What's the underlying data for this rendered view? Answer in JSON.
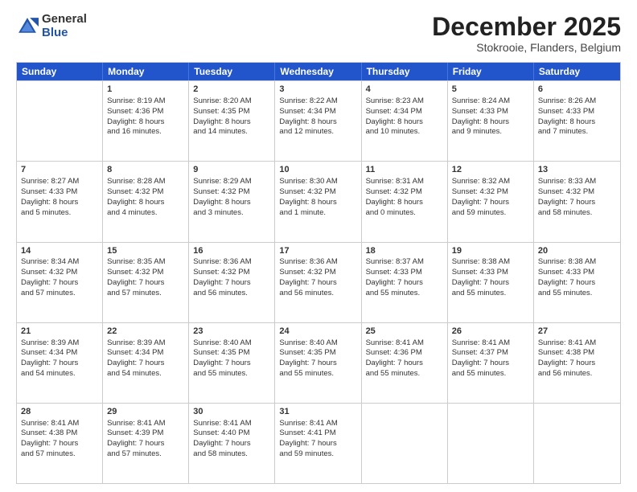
{
  "logo": {
    "general": "General",
    "blue": "Blue"
  },
  "title": "December 2025",
  "subtitle": "Stokrooie, Flanders, Belgium",
  "headers": [
    "Sunday",
    "Monday",
    "Tuesday",
    "Wednesday",
    "Thursday",
    "Friday",
    "Saturday"
  ],
  "rows": [
    [
      {
        "day": "",
        "lines": []
      },
      {
        "day": "1",
        "lines": [
          "Sunrise: 8:19 AM",
          "Sunset: 4:36 PM",
          "Daylight: 8 hours",
          "and 16 minutes."
        ]
      },
      {
        "day": "2",
        "lines": [
          "Sunrise: 8:20 AM",
          "Sunset: 4:35 PM",
          "Daylight: 8 hours",
          "and 14 minutes."
        ]
      },
      {
        "day": "3",
        "lines": [
          "Sunrise: 8:22 AM",
          "Sunset: 4:34 PM",
          "Daylight: 8 hours",
          "and 12 minutes."
        ]
      },
      {
        "day": "4",
        "lines": [
          "Sunrise: 8:23 AM",
          "Sunset: 4:34 PM",
          "Daylight: 8 hours",
          "and 10 minutes."
        ]
      },
      {
        "day": "5",
        "lines": [
          "Sunrise: 8:24 AM",
          "Sunset: 4:33 PM",
          "Daylight: 8 hours",
          "and 9 minutes."
        ]
      },
      {
        "day": "6",
        "lines": [
          "Sunrise: 8:26 AM",
          "Sunset: 4:33 PM",
          "Daylight: 8 hours",
          "and 7 minutes."
        ]
      }
    ],
    [
      {
        "day": "7",
        "lines": [
          "Sunrise: 8:27 AM",
          "Sunset: 4:33 PM",
          "Daylight: 8 hours",
          "and 5 minutes."
        ]
      },
      {
        "day": "8",
        "lines": [
          "Sunrise: 8:28 AM",
          "Sunset: 4:32 PM",
          "Daylight: 8 hours",
          "and 4 minutes."
        ]
      },
      {
        "day": "9",
        "lines": [
          "Sunrise: 8:29 AM",
          "Sunset: 4:32 PM",
          "Daylight: 8 hours",
          "and 3 minutes."
        ]
      },
      {
        "day": "10",
        "lines": [
          "Sunrise: 8:30 AM",
          "Sunset: 4:32 PM",
          "Daylight: 8 hours",
          "and 1 minute."
        ]
      },
      {
        "day": "11",
        "lines": [
          "Sunrise: 8:31 AM",
          "Sunset: 4:32 PM",
          "Daylight: 8 hours",
          "and 0 minutes."
        ]
      },
      {
        "day": "12",
        "lines": [
          "Sunrise: 8:32 AM",
          "Sunset: 4:32 PM",
          "Daylight: 7 hours",
          "and 59 minutes."
        ]
      },
      {
        "day": "13",
        "lines": [
          "Sunrise: 8:33 AM",
          "Sunset: 4:32 PM",
          "Daylight: 7 hours",
          "and 58 minutes."
        ]
      }
    ],
    [
      {
        "day": "14",
        "lines": [
          "Sunrise: 8:34 AM",
          "Sunset: 4:32 PM",
          "Daylight: 7 hours",
          "and 57 minutes."
        ]
      },
      {
        "day": "15",
        "lines": [
          "Sunrise: 8:35 AM",
          "Sunset: 4:32 PM",
          "Daylight: 7 hours",
          "and 57 minutes."
        ]
      },
      {
        "day": "16",
        "lines": [
          "Sunrise: 8:36 AM",
          "Sunset: 4:32 PM",
          "Daylight: 7 hours",
          "and 56 minutes."
        ]
      },
      {
        "day": "17",
        "lines": [
          "Sunrise: 8:36 AM",
          "Sunset: 4:32 PM",
          "Daylight: 7 hours",
          "and 56 minutes."
        ]
      },
      {
        "day": "18",
        "lines": [
          "Sunrise: 8:37 AM",
          "Sunset: 4:33 PM",
          "Daylight: 7 hours",
          "and 55 minutes."
        ]
      },
      {
        "day": "19",
        "lines": [
          "Sunrise: 8:38 AM",
          "Sunset: 4:33 PM",
          "Daylight: 7 hours",
          "and 55 minutes."
        ]
      },
      {
        "day": "20",
        "lines": [
          "Sunrise: 8:38 AM",
          "Sunset: 4:33 PM",
          "Daylight: 7 hours",
          "and 55 minutes."
        ]
      }
    ],
    [
      {
        "day": "21",
        "lines": [
          "Sunrise: 8:39 AM",
          "Sunset: 4:34 PM",
          "Daylight: 7 hours",
          "and 54 minutes."
        ]
      },
      {
        "day": "22",
        "lines": [
          "Sunrise: 8:39 AM",
          "Sunset: 4:34 PM",
          "Daylight: 7 hours",
          "and 54 minutes."
        ]
      },
      {
        "day": "23",
        "lines": [
          "Sunrise: 8:40 AM",
          "Sunset: 4:35 PM",
          "Daylight: 7 hours",
          "and 55 minutes."
        ]
      },
      {
        "day": "24",
        "lines": [
          "Sunrise: 8:40 AM",
          "Sunset: 4:35 PM",
          "Daylight: 7 hours",
          "and 55 minutes."
        ]
      },
      {
        "day": "25",
        "lines": [
          "Sunrise: 8:41 AM",
          "Sunset: 4:36 PM",
          "Daylight: 7 hours",
          "and 55 minutes."
        ]
      },
      {
        "day": "26",
        "lines": [
          "Sunrise: 8:41 AM",
          "Sunset: 4:37 PM",
          "Daylight: 7 hours",
          "and 55 minutes."
        ]
      },
      {
        "day": "27",
        "lines": [
          "Sunrise: 8:41 AM",
          "Sunset: 4:38 PM",
          "Daylight: 7 hours",
          "and 56 minutes."
        ]
      }
    ],
    [
      {
        "day": "28",
        "lines": [
          "Sunrise: 8:41 AM",
          "Sunset: 4:38 PM",
          "Daylight: 7 hours",
          "and 57 minutes."
        ]
      },
      {
        "day": "29",
        "lines": [
          "Sunrise: 8:41 AM",
          "Sunset: 4:39 PM",
          "Daylight: 7 hours",
          "and 57 minutes."
        ]
      },
      {
        "day": "30",
        "lines": [
          "Sunrise: 8:41 AM",
          "Sunset: 4:40 PM",
          "Daylight: 7 hours",
          "and 58 minutes."
        ]
      },
      {
        "day": "31",
        "lines": [
          "Sunrise: 8:41 AM",
          "Sunset: 4:41 PM",
          "Daylight: 7 hours",
          "and 59 minutes."
        ]
      },
      {
        "day": "",
        "lines": []
      },
      {
        "day": "",
        "lines": []
      },
      {
        "day": "",
        "lines": []
      }
    ]
  ]
}
